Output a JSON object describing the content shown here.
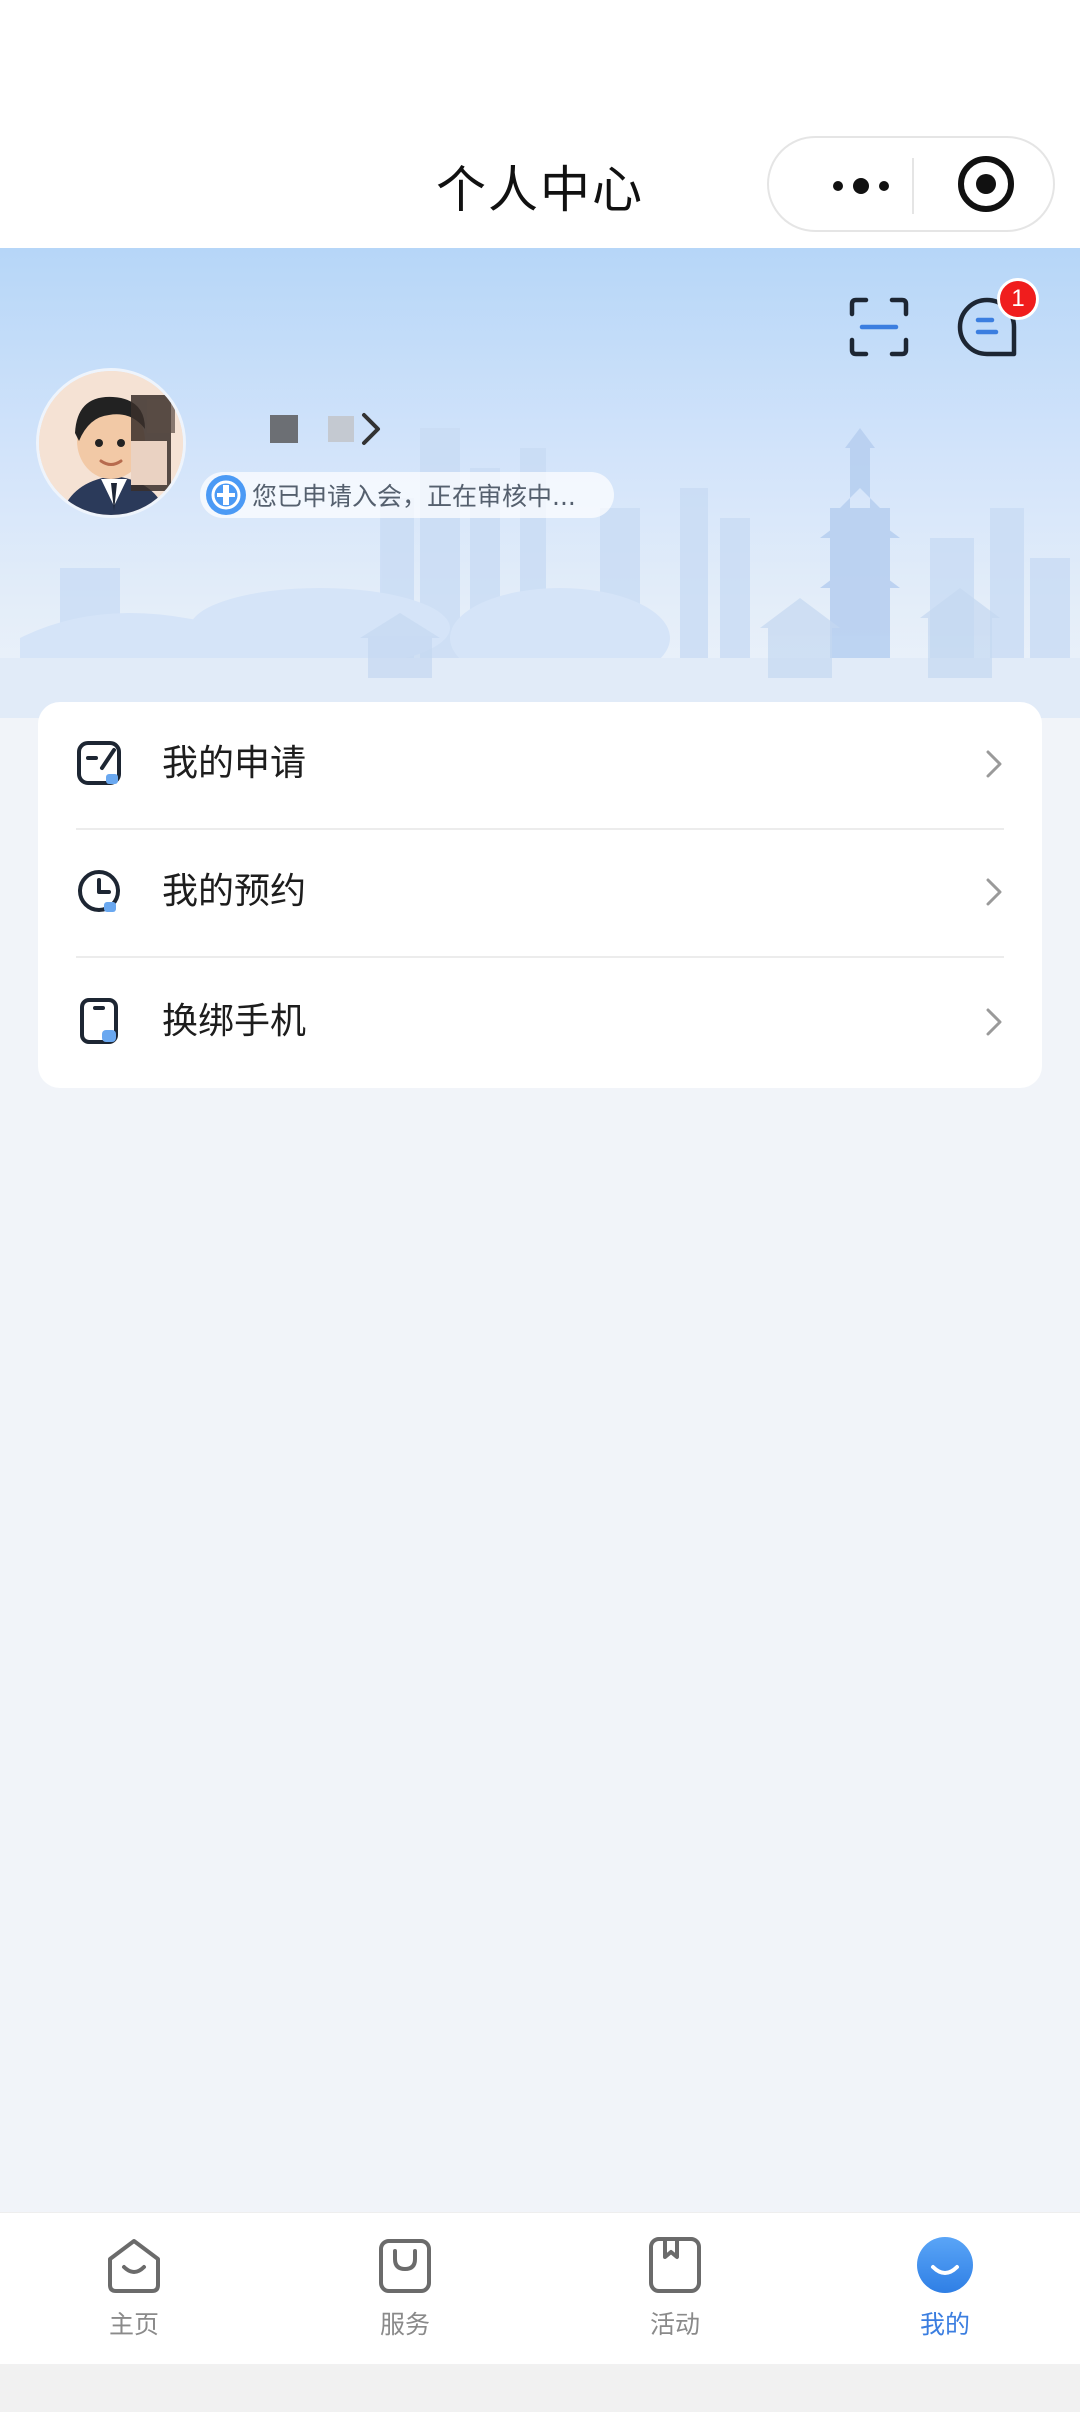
{
  "navbar": {
    "title": "个人中心"
  },
  "header": {
    "message_badge": "1",
    "status_text": "您已申请入会，正在审核中..."
  },
  "menu": {
    "items": [
      {
        "label": "我的申请",
        "icon": "edit-square-icon"
      },
      {
        "label": "我的预约",
        "icon": "clock-icon"
      },
      {
        "label": "换绑手机",
        "icon": "phone-icon"
      }
    ]
  },
  "tabbar": {
    "items": [
      {
        "label": "主页",
        "icon": "home-icon",
        "active": false
      },
      {
        "label": "服务",
        "icon": "bag-icon",
        "active": false
      },
      {
        "label": "活动",
        "icon": "bookmark-icon",
        "active": false
      },
      {
        "label": "我的",
        "icon": "profile-icon",
        "active": true
      }
    ]
  },
  "colors": {
    "accent": "#3b7ee0",
    "badge": "#f01d1d",
    "page_bg": "#f1f4f9"
  }
}
